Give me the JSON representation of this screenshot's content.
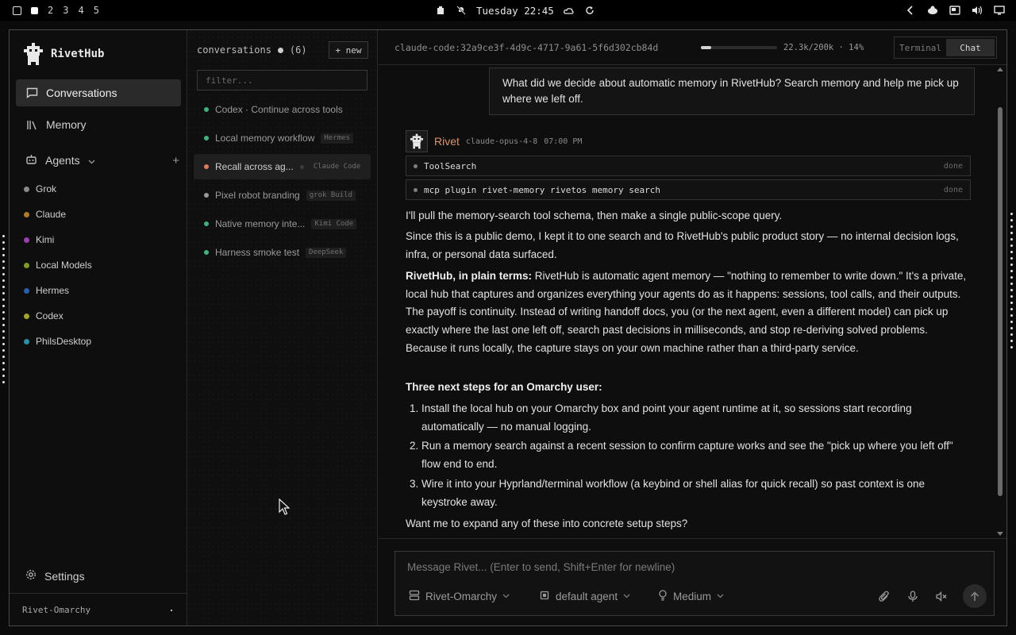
{
  "topbar": {
    "workspaces": [
      "2",
      "3",
      "4",
      "5"
    ],
    "clock": "Tuesday 22:45"
  },
  "sidebar": {
    "brand": "RivetHub",
    "nav": [
      {
        "label": "Conversations",
        "icon": "chat-icon",
        "active": true
      },
      {
        "label": "Memory",
        "icon": "library-icon",
        "active": false
      }
    ],
    "agents_label": "Agents",
    "agents": [
      {
        "name": "Grok",
        "color": "#8a8a8a"
      },
      {
        "name": "Claude",
        "color": "#b07a2a"
      },
      {
        "name": "Kimi",
        "color": "#9b3fb0"
      },
      {
        "name": "Local Models",
        "color": "#7e9a2a"
      },
      {
        "name": "Hermes",
        "color": "#2a5fb0"
      },
      {
        "name": "Codex",
        "color": "#a0a62a"
      },
      {
        "name": "PhilsDesktop",
        "color": "#2a8fa8"
      }
    ],
    "settings_label": "Settings",
    "footer": "Rivet-Omarchy"
  },
  "conversations": {
    "title": "conversations",
    "count": "(6)",
    "new_label": "+ new",
    "filter_placeholder": "filter...",
    "items": [
      {
        "title": "Codex · Continue across tools",
        "tag": "",
        "dot": "#3fb27f",
        "active": false
      },
      {
        "title": "Local memory workflow",
        "tag": "Hermes",
        "dot": "#3fb27f",
        "active": false
      },
      {
        "title": "Recall across ag...",
        "tag": "Claude Code",
        "dot": "#e07a5a",
        "active": true
      },
      {
        "title": "Pixel robot branding",
        "tag": "grok Build",
        "dot": "#9a9a9a",
        "active": false
      },
      {
        "title": "Native memory inte...",
        "tag": "Kimi Code",
        "dot": "#3fb27f",
        "active": false
      },
      {
        "title": "Harness smoke test",
        "tag": "DeepSeek",
        "dot": "#3fb27f",
        "active": false
      }
    ]
  },
  "main": {
    "session_id": "claude-code:32a9ce3f-4d9c-4717-9a61-5f6d302cb84d",
    "context_text": "22.3k/200k · 14%",
    "context_fraction": 0.14,
    "modes": [
      "Terminal",
      "Chat"
    ],
    "active_mode": "Chat",
    "user_message": "What did we decide about automatic memory in RivetHub? Search memory and help me pick up where we left off.",
    "assistant": {
      "name": "Rivet",
      "model": "claude-opus-4-8",
      "time": "07:00 PM"
    },
    "tools": [
      {
        "name": "ToolSearch",
        "status": "done"
      },
      {
        "name": "mcp plugin rivet-memory rivetos memory search",
        "status": "done"
      }
    ],
    "p1": "I'll pull the memory-search tool schema, then make a single public-scope query.",
    "p2": "Since this is a public demo, I kept it to one search and to RivetHub's public product story — no internal decision logs, infra, or personal data surfaced.",
    "p3_bold": "RivetHub, in plain terms:",
    "p3": " RivetHub is automatic agent memory — \"nothing to remember to write down.\" It's a private, local hub that captures and organizes everything your agents do as it happens: sessions, tool calls, and their outputs. The payoff is continuity. Instead of writing handoff docs, you (or the next agent, even a different model) can pick up exactly where the last one left off, search past decisions in milliseconds, and stop re-deriving solved problems. Because it runs locally, the capture stays on your own machine rather than a third-party service.",
    "steps_heading": "Three next steps for an Omarchy user:",
    "steps": [
      "Install the local hub on your Omarchy box and point your agent runtime at it, so sessions start recording automatically — no manual logging.",
      "Run a memory search against a recent session to confirm capture works and see the \"pick up where you left off\" flow end to end.",
      "Wire it into your Hyprland/terminal workflow (a keybind or shell alias for quick recall) so past context is one keystroke away."
    ],
    "closing": "Want me to expand any of these into concrete setup steps?",
    "composer": {
      "placeholder": "Message Rivet... (Enter to send, Shift+Enter for newline)",
      "machine": "Rivet-Omarchy",
      "agent": "default agent",
      "effort": "Medium"
    }
  }
}
